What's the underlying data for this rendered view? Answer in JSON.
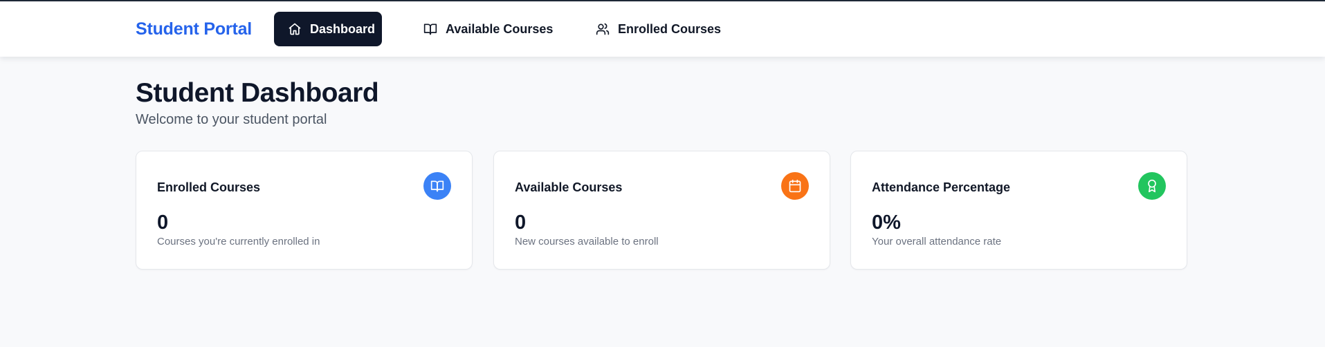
{
  "nav": {
    "brand": "Student Portal",
    "items": [
      {
        "label": "Dashboard",
        "icon": "home-icon",
        "active": true
      },
      {
        "label": "Available Courses",
        "icon": "book-open-icon",
        "active": false
      },
      {
        "label": "Enrolled Courses",
        "icon": "users-icon",
        "active": false
      }
    ]
  },
  "header": {
    "title": "Student Dashboard",
    "subtitle": "Welcome to your student portal"
  },
  "cards": [
    {
      "title": "Enrolled Courses",
      "value": "0",
      "description": "Courses you're currently enrolled in",
      "icon": "book-open-icon",
      "color": "#3b82f6"
    },
    {
      "title": "Available Courses",
      "value": "0",
      "description": "New courses available to enroll",
      "icon": "calendar-icon",
      "color": "#f97316"
    },
    {
      "title": "Attendance Percentage",
      "value": "0%",
      "description": "Your overall attendance rate",
      "icon": "award-icon",
      "color": "#22c55e"
    }
  ],
  "colors": {
    "brand": "#2563eb",
    "active_nav_bg": "#0f172a",
    "page_bg": "#f8f9fb"
  }
}
